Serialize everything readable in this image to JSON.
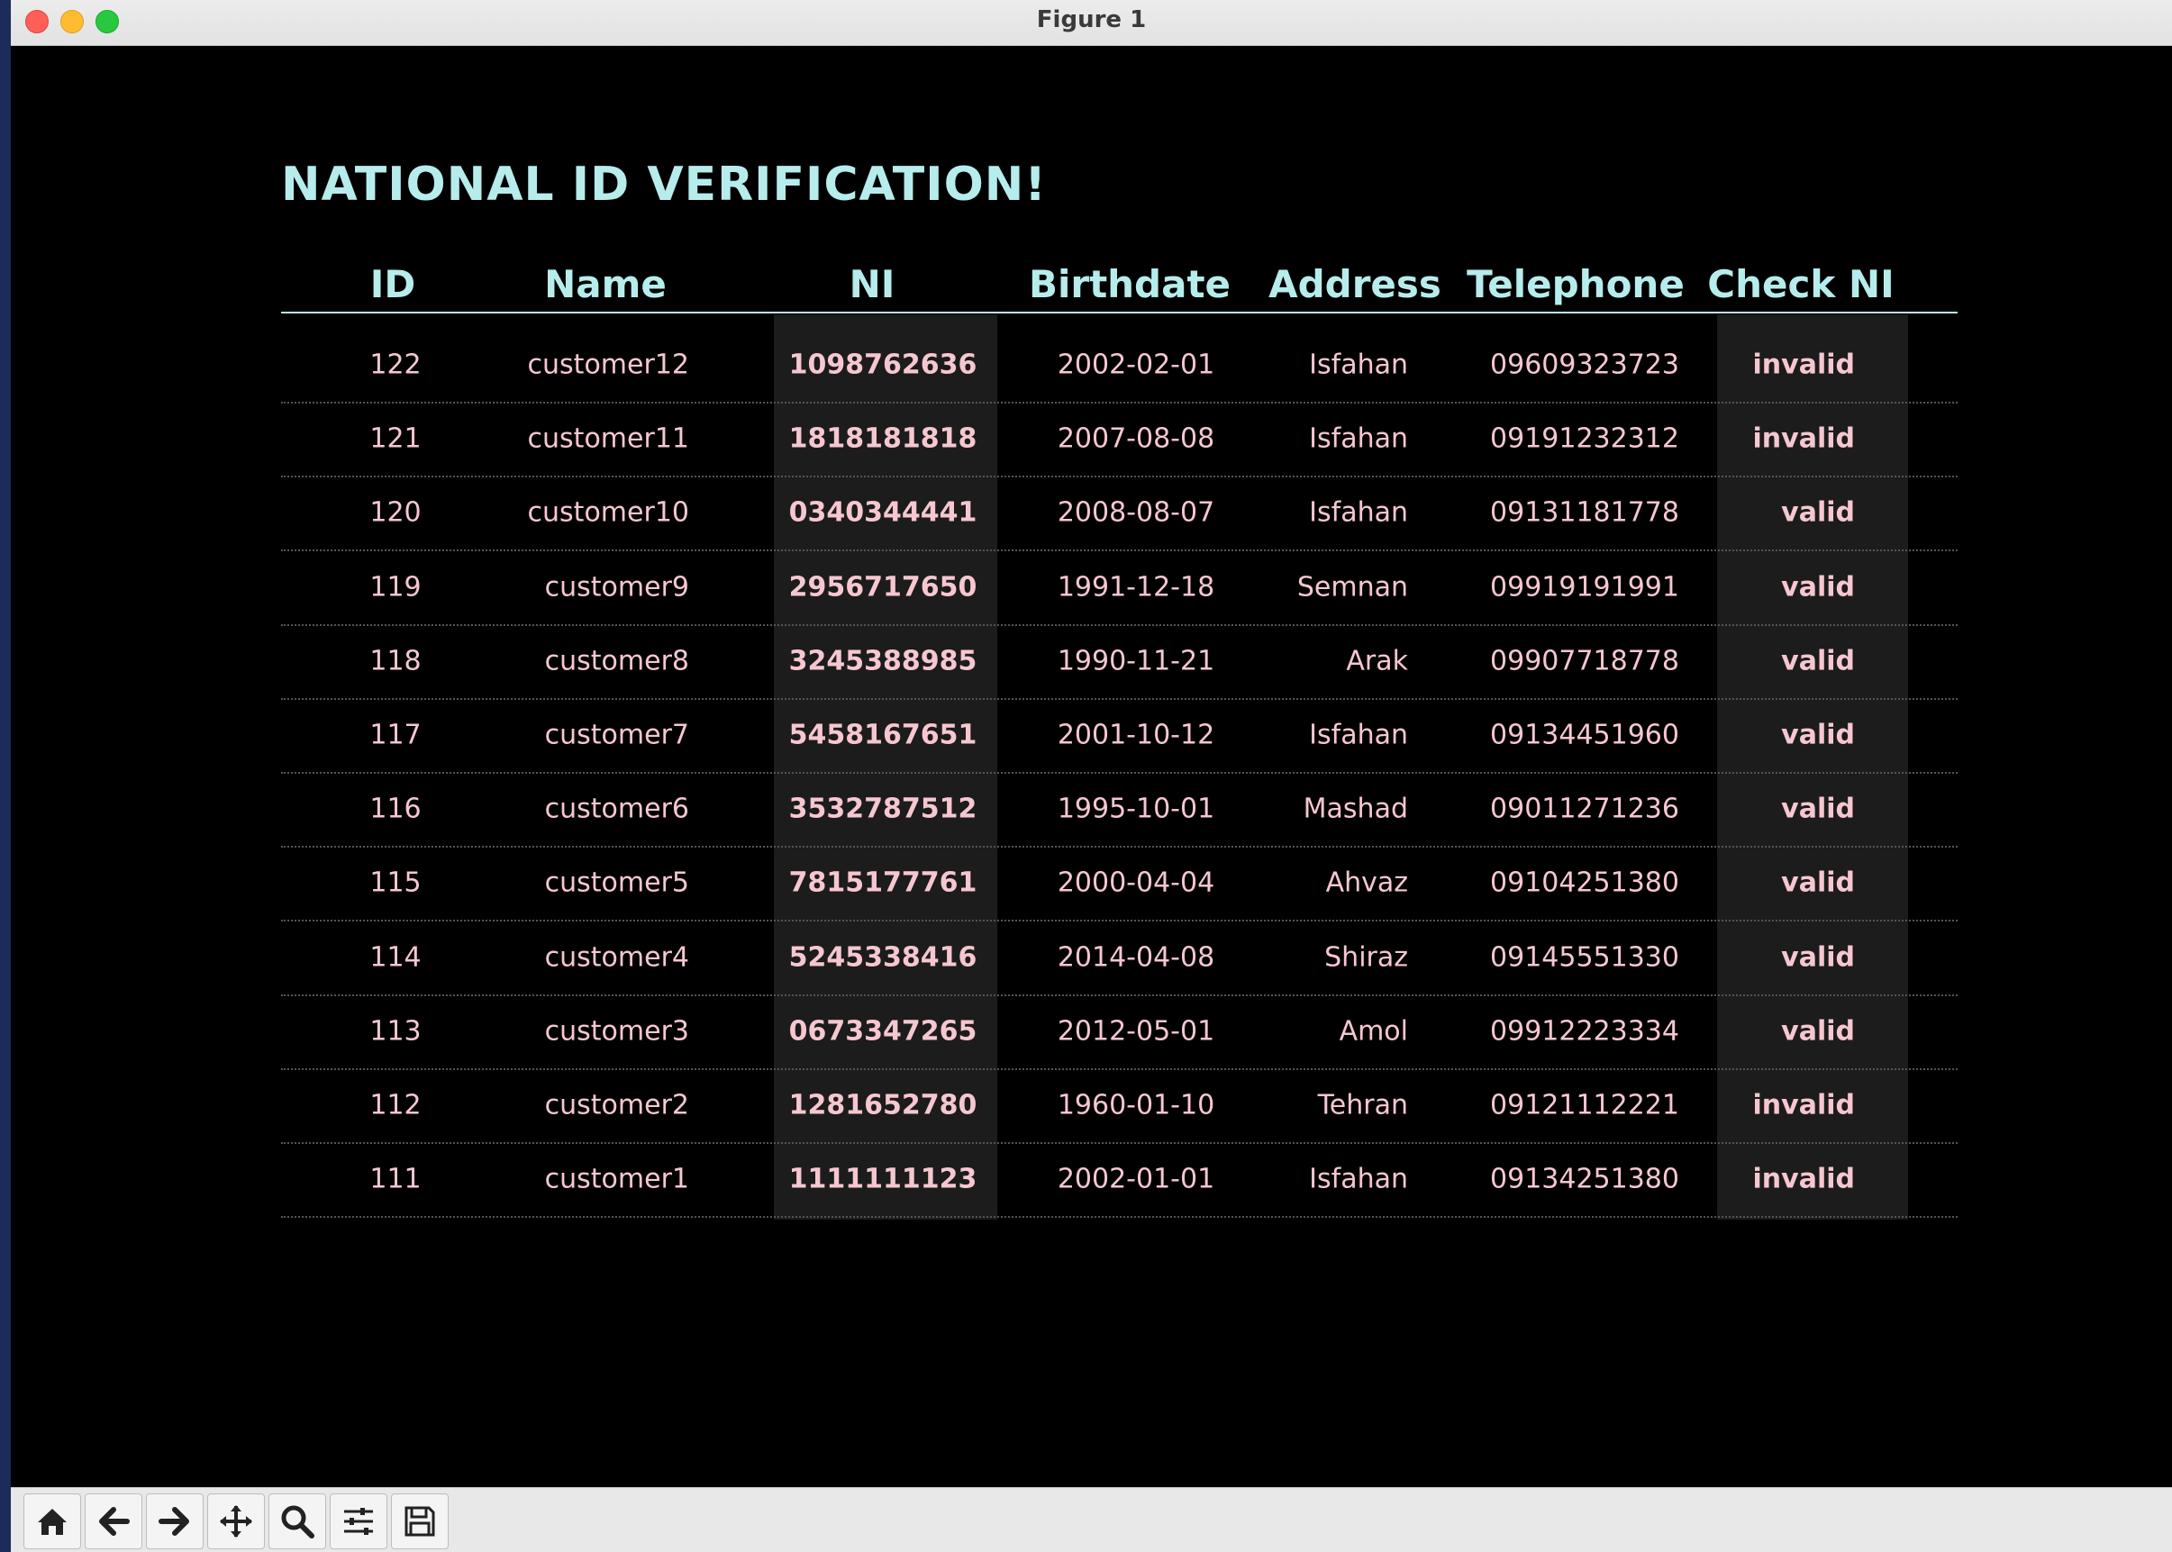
{
  "window": {
    "title": "Figure 1"
  },
  "figure": {
    "heading": "NATIONAL ID VERIFICATION!",
    "columns": [
      "ID",
      "Name",
      "NI",
      "Birthdate",
      "Address",
      "Telephone",
      "Check NI"
    ],
    "rows": [
      [
        "122",
        "customer12",
        "1098762636",
        "2002-02-01",
        "Isfahan",
        "09609323723",
        "invalid"
      ],
      [
        "121",
        "customer11",
        "1818181818",
        "2007-08-08",
        "Isfahan",
        "09191232312",
        "invalid"
      ],
      [
        "120",
        "customer10",
        "0340344441",
        "2008-08-07",
        "Isfahan",
        "09131181778",
        "valid"
      ],
      [
        "119",
        "customer9",
        "2956717650",
        "1991-12-18",
        "Semnan",
        "09919191991",
        "valid"
      ],
      [
        "118",
        "customer8",
        "3245388985",
        "1990-11-21",
        "Arak",
        "09907718778",
        "valid"
      ],
      [
        "117",
        "customer7",
        "5458167651",
        "2001-10-12",
        "Isfahan",
        "09134451960",
        "valid"
      ],
      [
        "116",
        "customer6",
        "3532787512",
        "1995-10-01",
        "Mashad",
        "09011271236",
        "valid"
      ],
      [
        "115",
        "customer5",
        "7815177761",
        "2000-04-04",
        "Ahvaz",
        "09104251380",
        "valid"
      ],
      [
        "114",
        "customer4",
        "5245338416",
        "2014-04-08",
        "Shiraz",
        "09145551330",
        "valid"
      ],
      [
        "113",
        "customer3",
        "0673347265",
        "2012-05-01",
        "Amol",
        "09912223334",
        "valid"
      ],
      [
        "112",
        "customer2",
        "1281652780",
        "1960-01-10",
        "Tehran",
        "09121112221",
        "invalid"
      ],
      [
        "111",
        "customer1",
        "1111111123",
        "2002-01-01",
        "Isfahan",
        "09134251380",
        "invalid"
      ]
    ]
  },
  "colors": {
    "background": "#000000",
    "header_text": "#b7ecec",
    "cell_text": "#f6c7d0",
    "highlight_column": "#1c1c1c"
  },
  "toolbar": {
    "buttons": [
      "home-icon",
      "back-arrow-icon",
      "forward-arrow-icon",
      "pan-icon",
      "zoom-icon",
      "configure-subplots-icon",
      "save-icon"
    ]
  }
}
